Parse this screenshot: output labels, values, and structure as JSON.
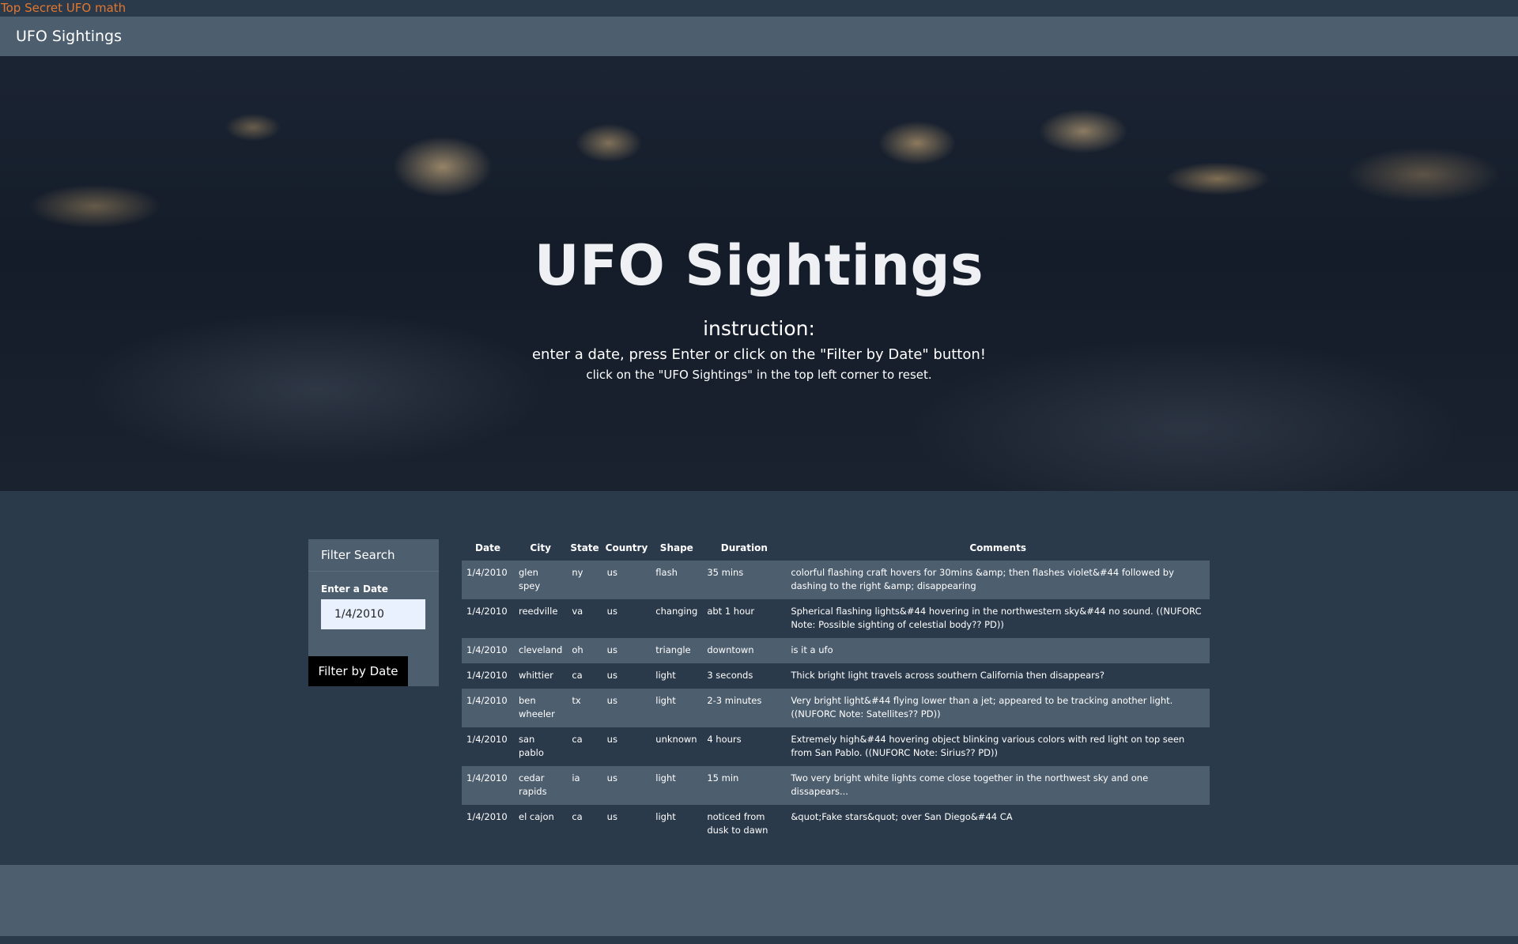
{
  "top_link": "Top Secret UFO math",
  "navbar": {
    "brand": "UFO Sightings"
  },
  "hero": {
    "title": "UFO Sightings",
    "instruction": "instruction:",
    "line1": "enter a date, press Enter or click on the \"Filter by Date\" button!",
    "line2": "click on the \"UFO Sightings\" in the top left corner to reset."
  },
  "filter": {
    "heading": "Filter Search",
    "label": "Enter a Date",
    "value": "1/4/2010",
    "button": "Filter by Date"
  },
  "table": {
    "headers": [
      "Date",
      "City",
      "State",
      "Country",
      "Shape",
      "Duration",
      "Comments"
    ],
    "rows": [
      [
        "1/4/2010",
        "glen spey",
        "ny",
        "us",
        "flash",
        "35 mins",
        "colorful flashing craft hovers for 30mins &amp; then flashes violet&#44 followed by dashing to the right &amp; disappearing"
      ],
      [
        "1/4/2010",
        "reedville",
        "va",
        "us",
        "changing",
        "abt 1 hour",
        "Spherical flashing lights&#44 hovering in the northwestern sky&#44 no sound. ((NUFORC Note: Possible sighting of celestial body?? PD))"
      ],
      [
        "1/4/2010",
        "cleveland",
        "oh",
        "us",
        "triangle",
        "downtown",
        "is it a ufo"
      ],
      [
        "1/4/2010",
        "whittier",
        "ca",
        "us",
        "light",
        "3 seconds",
        "Thick bright light travels across southern California then disappears?"
      ],
      [
        "1/4/2010",
        "ben wheeler",
        "tx",
        "us",
        "light",
        "2-3 minutes",
        "Very bright light&#44 flying lower than a jet; appeared to be tracking another light. ((NUFORC Note: Satellites?? PD))"
      ],
      [
        "1/4/2010",
        "san pablo",
        "ca",
        "us",
        "unknown",
        "4 hours",
        "Extremely high&#44 hovering object blinking various colors with red light on top seen from San Pablo. ((NUFORC Note: Sirius?? PD))"
      ],
      [
        "1/4/2010",
        "cedar rapids",
        "ia",
        "us",
        "light",
        "15 min",
        "Two very bright white lights come close together in the northwest sky and one dissapears..."
      ],
      [
        "1/4/2010",
        "el cajon",
        "ca",
        "us",
        "light",
        "noticed from dusk to dawn",
        "&quot;Fake stars&quot; over San Diego&#44 CA"
      ]
    ]
  }
}
